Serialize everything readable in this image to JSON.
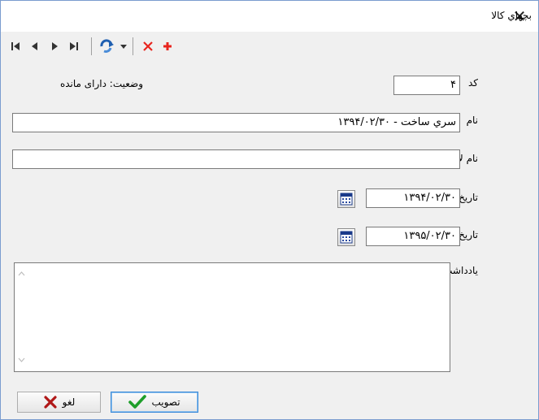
{
  "window": {
    "title": "بچهاي کالا",
    "close_glyph": "✕"
  },
  "toolbar": {
    "icons": [
      "first-record-icon",
      "prev-record-icon",
      "next-record-icon",
      "last-record-icon",
      "refresh-icon",
      "dropdown-arrow-icon",
      "delete-icon",
      "add-icon"
    ],
    "delete_color": "#e8251e",
    "add_color": "#e8251e"
  },
  "form": {
    "code_label": "کد",
    "code_value": "۴",
    "status_text": "وضعیت: دارای مانده",
    "name_label": "نام",
    "name_value": "سري ساخت - ۱۳۹۴/۰۲/۳۰",
    "latin_name_label": "نام لاتین",
    "latin_name_value": "",
    "date_label": "تاریخ",
    "date_value": "۱۳۹۴/۰۲/۳۰",
    "expiry_label": "تاریخ انقضاء",
    "expiry_value": "۱۳۹۵/۰۲/۳۰",
    "note_label": "یادداشت",
    "note_value": ""
  },
  "buttons": {
    "approve_label": "تصویب",
    "cancel_label": "لغو"
  },
  "colors": {
    "approve_check": "#1e9e2a",
    "cancel_x": "#b01818",
    "focus_border": "#3b8ad8"
  }
}
